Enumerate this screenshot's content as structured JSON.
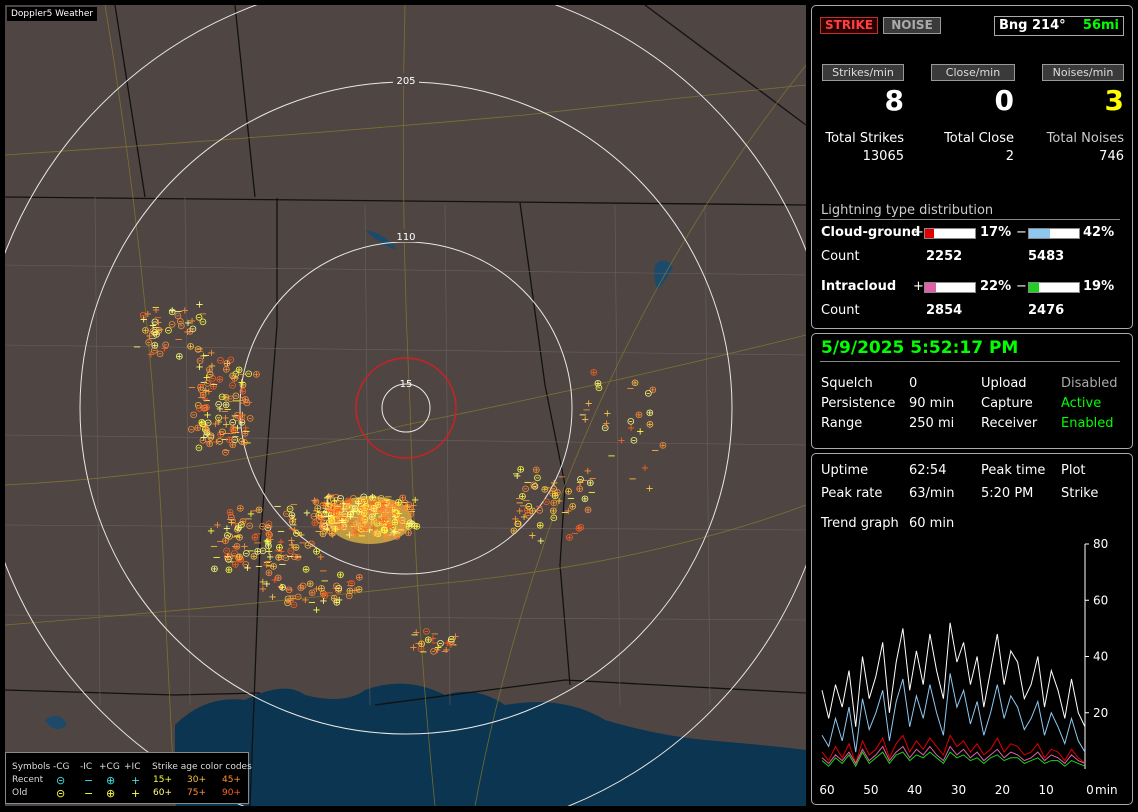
{
  "map": {
    "title": "Doppler5 Weather",
    "ring_labels": [
      "205",
      "110",
      "15"
    ]
  },
  "legend": {
    "symbols_label": "Symbols",
    "cg_minus": "-CG",
    "ic_minus": "-IC",
    "cg_plus": "+CG",
    "ic_plus": "+IC",
    "age_title": "Strike age color codes",
    "recent_label": "Recent",
    "old_label": "Old",
    "ages_recent": [
      "15+",
      "30+",
      "45+"
    ],
    "ages_old": [
      "60+",
      "75+",
      "90+"
    ],
    "symbol_glyphs": {
      "cg_minus": "⊝",
      "ic_minus": "−",
      "cg_plus": "⊕",
      "ic_plus": "+"
    }
  },
  "header": {
    "strike_btn": "STRIKE",
    "noise_btn": "NOISE",
    "bearing": "Bng 214°",
    "distance": "56mi"
  },
  "rates": {
    "strikes_label": "Strikes/min",
    "close_label": "Close/min",
    "noises_label": "Noises/min",
    "strikes": "8",
    "close": "0",
    "noises": "3"
  },
  "totals": {
    "strikes_label": "Total Strikes",
    "close_label": "Total Close",
    "noises_label": "Total Noises",
    "strikes": "13065",
    "close": "2",
    "noises": "746"
  },
  "distribution": {
    "title": "Lightning type distribution",
    "cg_label": "Cloud-ground",
    "ic_label": "Intracloud",
    "count_label": "Count",
    "plus": "+",
    "minus": "−",
    "cg_plus_pct": "17%",
    "cg_minus_pct": "42%",
    "cg_plus_count": "2252",
    "cg_minus_count": "5483",
    "ic_plus_pct": "22%",
    "ic_minus_pct": "19%",
    "ic_plus_count": "2854",
    "ic_minus_count": "2476",
    "cg_plus_fill": 0.17,
    "cg_minus_fill": 0.42,
    "ic_plus_fill": 0.22,
    "ic_minus_fill": 0.19,
    "colors": {
      "cg_plus": "#e00000",
      "cg_minus": "#8ec8f0",
      "ic_plus": "#e060a8",
      "ic_minus": "#20d020"
    }
  },
  "status": {
    "datetime": "5/9/2025 5:52:17 PM",
    "squelch_label": "Squelch",
    "squelch": "0",
    "upload_label": "Upload",
    "upload": "Disabled",
    "persistence_label": "Persistence",
    "persistence": "90 min",
    "capture_label": "Capture",
    "capture": "Active",
    "range_label": "Range",
    "range": "250 mi",
    "receiver_label": "Receiver",
    "receiver": "Enabled"
  },
  "stats": {
    "uptime_label": "Uptime",
    "uptime": "62:54",
    "peak_time_label": "Peak time",
    "plot_label": "Plot",
    "peak_rate_label": "Peak rate",
    "peak_rate": "63/min",
    "peak_time": "5:20 PM",
    "plot": "Strike",
    "trend_label": "Trend graph",
    "trend": "60 min"
  },
  "chart_data": {
    "type": "line",
    "xlabel": "min",
    "x_ticks": [
      "60",
      "50",
      "40",
      "30",
      "20",
      "10",
      "0"
    ],
    "y_ticks": [
      "80",
      "60",
      "40",
      "20"
    ],
    "ylim": [
      0,
      80
    ],
    "xlim": [
      60,
      0
    ],
    "series": [
      {
        "color": "#ffffff",
        "values": [
          28,
          18,
          30,
          22,
          35,
          15,
          40,
          25,
          33,
          45,
          20,
          38,
          50,
          28,
          42,
          30,
          48,
          35,
          25,
          52,
          38,
          45,
          30,
          40,
          22,
          35,
          48,
          30,
          42,
          38,
          25,
          30,
          40,
          22,
          35,
          28,
          18,
          32,
          20,
          15
        ]
      },
      {
        "color": "#8ec8f0",
        "values": [
          12,
          8,
          18,
          10,
          22,
          6,
          25,
          14,
          20,
          28,
          10,
          24,
          32,
          15,
          26,
          18,
          30,
          20,
          12,
          34,
          22,
          28,
          16,
          24,
          12,
          20,
          30,
          18,
          26,
          22,
          14,
          18,
          24,
          12,
          20,
          15,
          9,
          18,
          10,
          6
        ]
      },
      {
        "color": "#e00000",
        "values": [
          6,
          3,
          8,
          4,
          9,
          2,
          10,
          5,
          7,
          11,
          4,
          9,
          12,
          6,
          10,
          7,
          11,
          8,
          5,
          12,
          8,
          10,
          6,
          9,
          5,
          7,
          11,
          6,
          9,
          8,
          5,
          6,
          9,
          4,
          7,
          6,
          3,
          7,
          4,
          2
        ]
      },
      {
        "color": "#e060a8",
        "values": [
          4,
          2,
          5,
          3,
          6,
          2,
          7,
          3,
          5,
          8,
          3,
          6,
          8,
          4,
          7,
          5,
          8,
          5,
          3,
          8,
          5,
          7,
          4,
          6,
          3,
          5,
          7,
          4,
          6,
          5,
          3,
          4,
          6,
          3,
          5,
          4,
          2,
          5,
          3,
          2
        ]
      },
      {
        "color": "#20d020",
        "values": [
          3,
          1,
          4,
          2,
          5,
          1,
          6,
          2,
          4,
          6,
          2,
          5,
          6,
          3,
          5,
          4,
          6,
          4,
          2,
          6,
          4,
          5,
          3,
          4,
          2,
          4,
          5,
          3,
          4,
          4,
          2,
          3,
          4,
          2,
          3,
          3,
          1,
          3,
          2,
          1
        ]
      }
    ]
  },
  "colors": {
    "map_bg": "#4f4644",
    "water": "#0b3550",
    "green_text": "#00ff00",
    "yellow_text": "#ffff00",
    "strike_btn": "#ff4040",
    "close_ring": "#d02020",
    "age_recent": [
      "#ffff40",
      "#ffc040",
      "#ff9030"
    ],
    "age_old": [
      "#ffff80",
      "#ff9040",
      "#ff6020"
    ]
  }
}
